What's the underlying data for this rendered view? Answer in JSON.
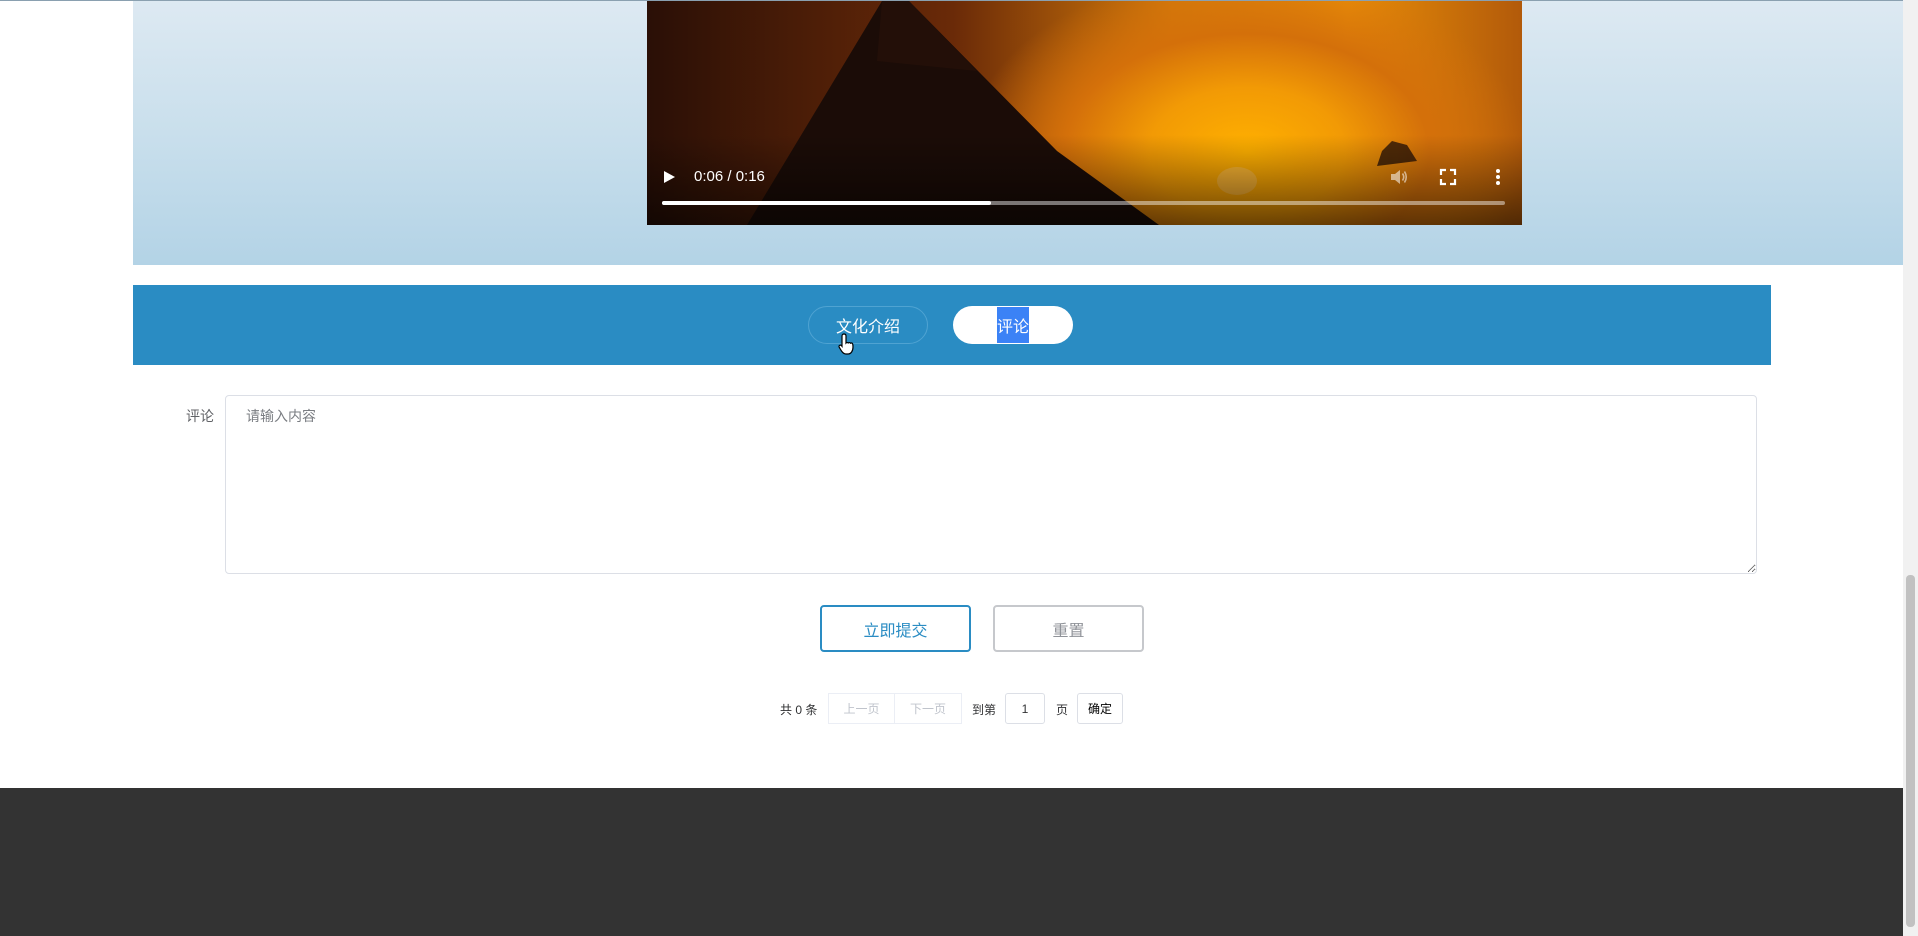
{
  "video": {
    "time_display": "0:06 / 0:16",
    "progress": 0.39
  },
  "tabs": [
    {
      "label": "文化介绍",
      "active": false
    },
    {
      "label": "评论",
      "active": true
    }
  ],
  "comment_form": {
    "label": "评论",
    "placeholder": "请输入内容",
    "value": "",
    "submit_label": "立即提交",
    "reset_label": "重置"
  },
  "pagination": {
    "total_text": "共 0 条",
    "prev_label": "上一页",
    "next_label": "下一页",
    "goto_label": "到第",
    "page_value": "1",
    "page_unit": "页",
    "confirm_label": "确定"
  },
  "colors": {
    "accent": "#2a8cc3",
    "footer": "#333333"
  }
}
